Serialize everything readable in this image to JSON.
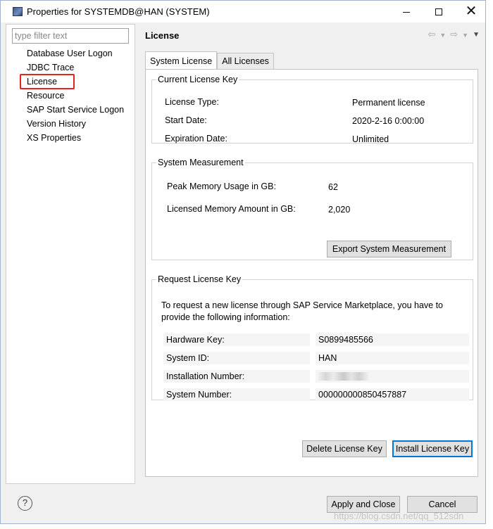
{
  "window": {
    "title": "Properties for SYSTEMDB@HAN (SYSTEM)"
  },
  "sidebar": {
    "filter_placeholder": "type filter text",
    "items": [
      {
        "label": "Database User Logon"
      },
      {
        "label": "JDBC Trace"
      },
      {
        "label": "License",
        "selected": true
      },
      {
        "label": "Resource"
      },
      {
        "label": "SAP Start Service Logon"
      },
      {
        "label": "Version History"
      },
      {
        "label": "XS Properties"
      }
    ]
  },
  "page": {
    "title": "License",
    "tabs": [
      {
        "label": "System License",
        "active": true
      },
      {
        "label": "All Licenses"
      }
    ]
  },
  "current_license": {
    "legend": "Current License Key",
    "rows": [
      {
        "label": "License Type:",
        "value": "Permanent license"
      },
      {
        "label": "Start Date:",
        "value": "2020-2-16 0:00:00"
      },
      {
        "label": "Expiration Date:",
        "value": "Unlimited"
      }
    ]
  },
  "measurement": {
    "legend": "System Measurement",
    "rows": [
      {
        "label": "Peak Memory Usage in GB:",
        "value": "62"
      },
      {
        "label": "Licensed Memory Amount in GB:",
        "value": "2,020"
      }
    ],
    "export_button": "Export System Measurement"
  },
  "request": {
    "legend": "Request License Key",
    "intro_line1": "To request a new license through SAP Service Marketplace, you have to",
    "intro_line2": "provide the following information:",
    "rows": [
      {
        "label": "Hardware Key:",
        "value": "S0899485566"
      },
      {
        "label": "System ID:",
        "value": "HAN"
      },
      {
        "label": "Installation Number:",
        "value": ""
      },
      {
        "label": "System Number:",
        "value": "000000000850457887"
      }
    ]
  },
  "actions": {
    "delete_label": "Delete License Key",
    "install_label": "Install License Key"
  },
  "footer": {
    "apply_close_label": "Apply and Close",
    "cancel_label": "Cancel",
    "help_symbol": "?"
  },
  "watermark": {
    "text": "https://blog.csdn.net/qq_512sdn"
  },
  "colors": {
    "highlight": "#e0261c",
    "focus": "#0078d7"
  }
}
